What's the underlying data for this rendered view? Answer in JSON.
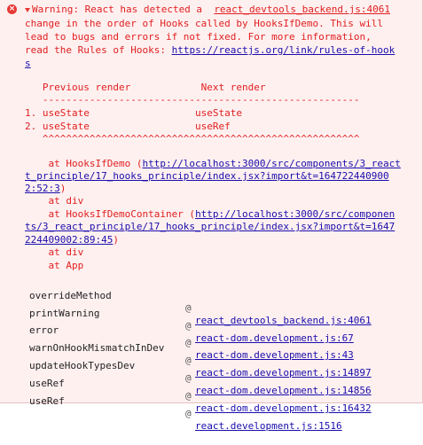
{
  "warning": {
    "prefix": "Warning: React has detected a ",
    "source_link": "react_devtools_backend.js:4061",
    "message_lines": [
      "change in the order of Hooks called by HooksIfDemo. This will",
      "lead to bugs and errors if not fixed. For more information,"
    ],
    "rules_prefix": "read the Rules of Hooks: ",
    "rules_link_a": "https://reactjs.org/link/rules-of-hook",
    "rules_link_b": "s"
  },
  "comparison": {
    "header": "   Previous render            Next render",
    "divider": "   ------------------------------------------------------",
    "rows": [
      "1. useState                  useState",
      "2. useState                  useRef"
    ],
    "carets": "   ^^^^^^^^^^^^^^^^^^^^^^^^^^^^^^^^^^^^^^^^^^^^^^^^^^^^^^"
  },
  "component_stack": {
    "l1_prefix": "    at HooksIfDemo (",
    "l1_link": "http://localhost:3000/src/components/3_react",
    "l2_link": "t_principle/17_hooks_principle/index.jsx?import&t=164722440900",
    "l3_link": "2:52:3",
    "l3_suffix": ")",
    "l4": "    at div",
    "l5_prefix": "    at HooksIfDemoContainer (",
    "l5_link": "http://localhost:3000/src/componen",
    "l6_link": "ts/3_react_principle/17_hooks_principle/index.jsx?import&t=1647",
    "l7_link": "224409002:89:45",
    "l7_suffix": ")",
    "l8": "    at div",
    "l9": "    at App"
  },
  "call_stack": [
    {
      "fn": "overrideMethod",
      "at": "@",
      "src": "react_devtools_backend.js:4061"
    },
    {
      "fn": "printWarning",
      "at": "@",
      "src": "react-dom.development.js:67"
    },
    {
      "fn": "error",
      "at": "@",
      "src": "react-dom.development.js:43"
    },
    {
      "fn": "warnOnHookMismatchInDev",
      "at": "@",
      "src": "react-dom.development.js:14897"
    },
    {
      "fn": "updateHookTypesDev",
      "at": "@",
      "src": "react-dom.development.js:14856"
    },
    {
      "fn": "useRef",
      "at": "@",
      "src": "react-dom.development.js:16432"
    },
    {
      "fn": "useRef",
      "at": "@",
      "src": "react.development.js:1516"
    }
  ],
  "colors": {
    "error_red": "#e02020",
    "link_blue": "#1a0dab",
    "background": "#fff0f0"
  }
}
